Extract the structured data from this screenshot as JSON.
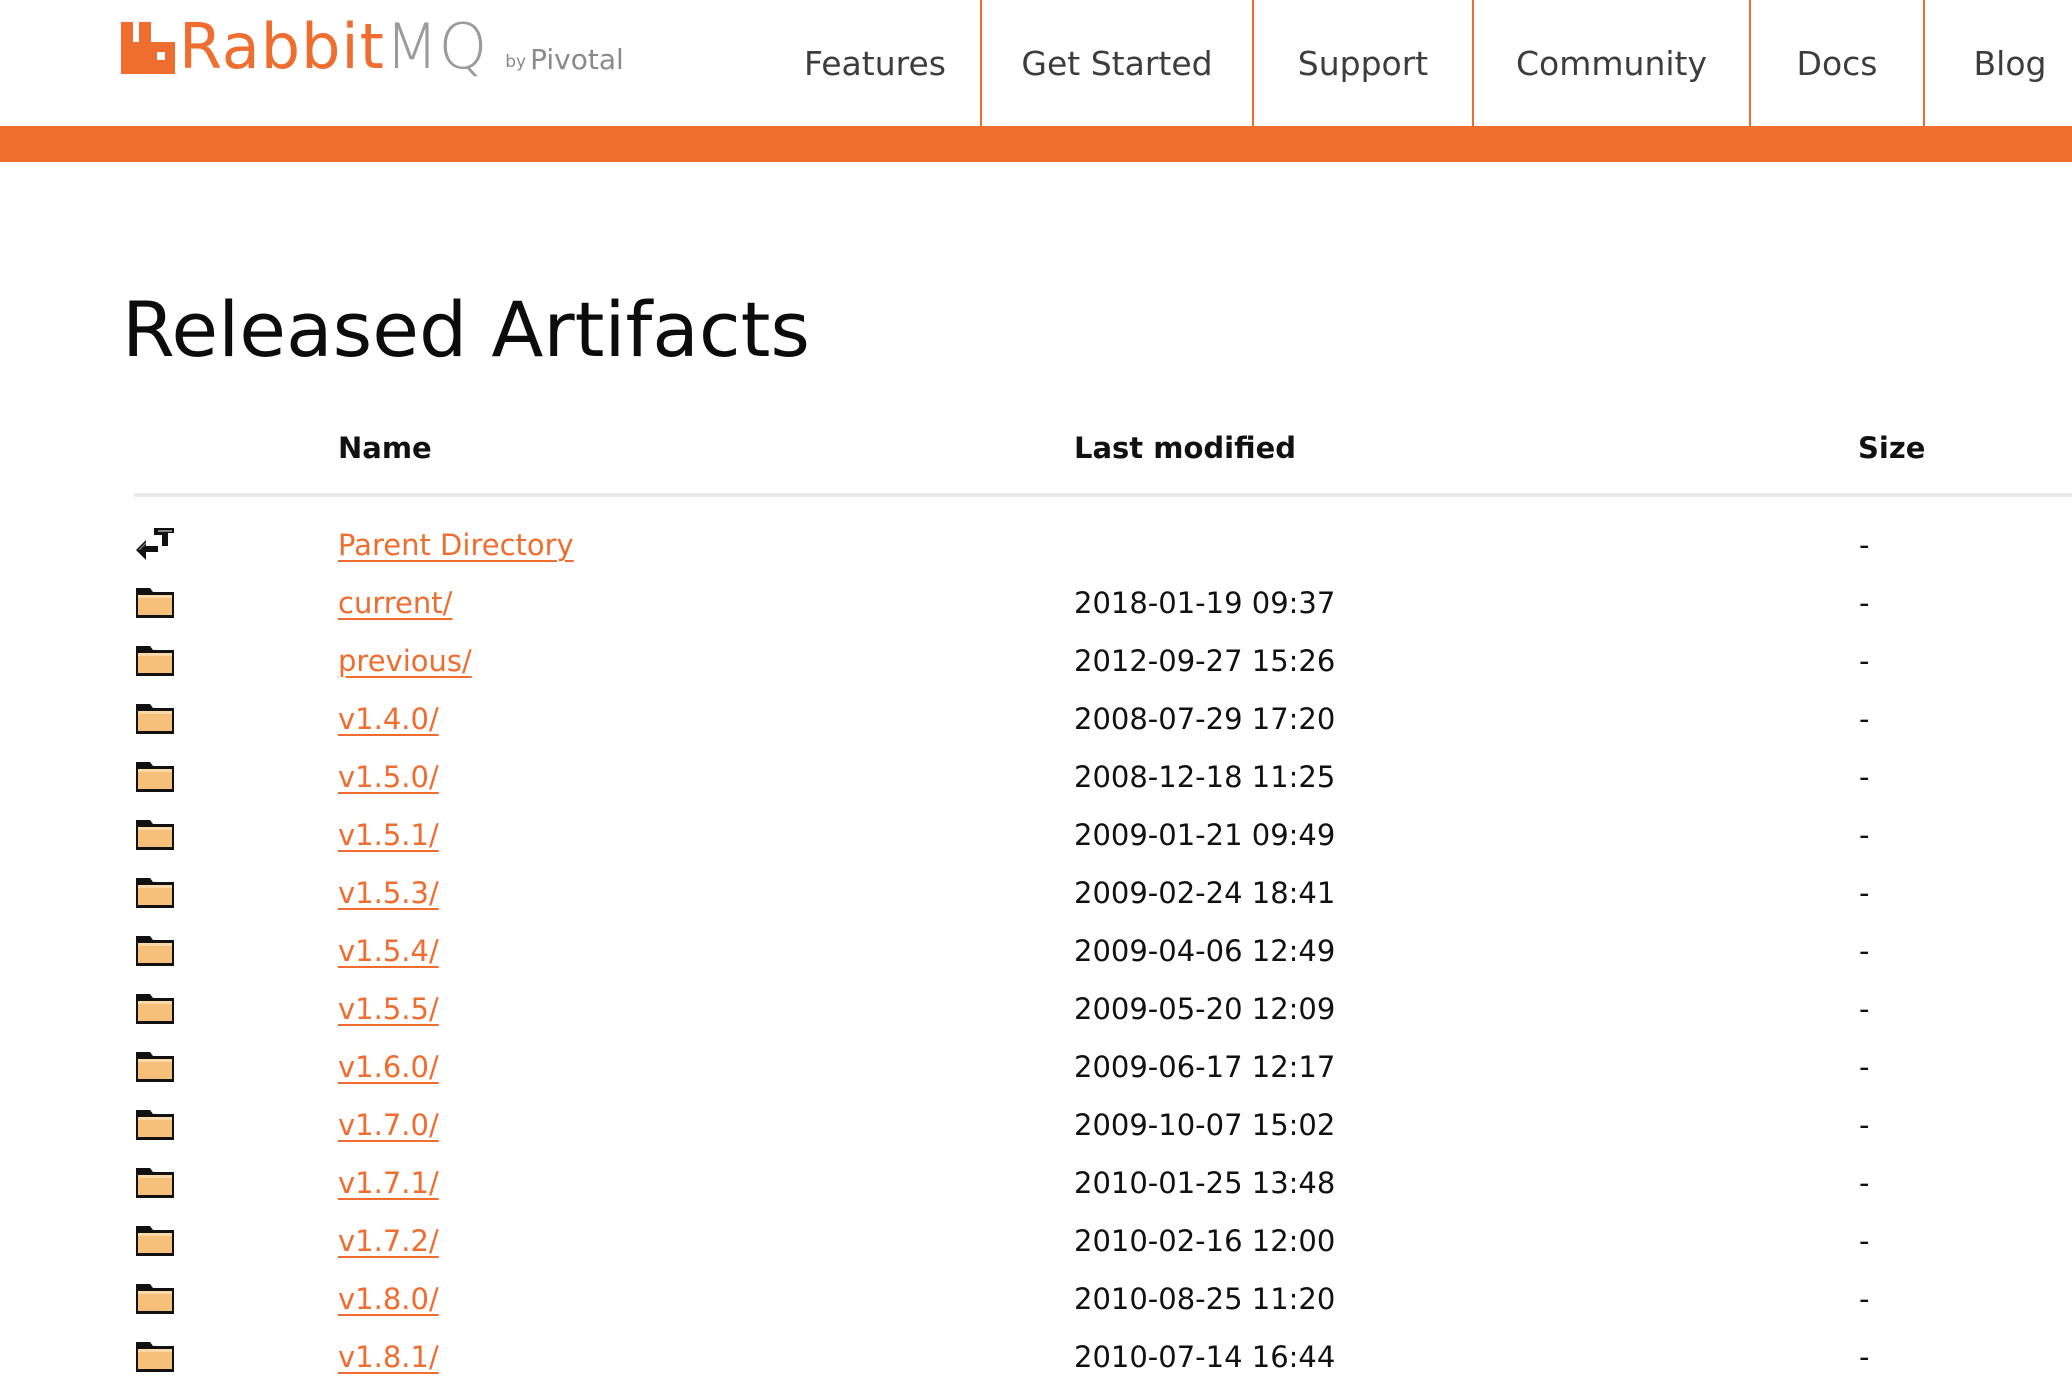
{
  "brand": {
    "name_part1": "Rabbit",
    "name_part2": "MQ",
    "by": "by",
    "company": "Pivotal",
    "accent_color": "#f06d30"
  },
  "nav": {
    "items": [
      {
        "label": "Features"
      },
      {
        "label": "Get Started"
      },
      {
        "label": "Support"
      },
      {
        "label": "Community"
      },
      {
        "label": "Docs"
      },
      {
        "label": "Blog"
      }
    ]
  },
  "page": {
    "title": "Released Artifacts"
  },
  "table": {
    "headers": {
      "name": "Name",
      "last_modified": "Last modified",
      "size": "Size"
    },
    "rows": [
      {
        "icon": "back-arrow-icon",
        "name": "Parent Directory",
        "date": "",
        "size": "-"
      },
      {
        "icon": "folder-icon",
        "name": "current/",
        "date": "2018-01-19 09:37",
        "size": "-"
      },
      {
        "icon": "folder-icon",
        "name": "previous/",
        "date": "2012-09-27 15:26",
        "size": "-"
      },
      {
        "icon": "folder-icon",
        "name": "v1.4.0/",
        "date": "2008-07-29 17:20",
        "size": "-"
      },
      {
        "icon": "folder-icon",
        "name": "v1.5.0/",
        "date": "2008-12-18 11:25",
        "size": "-"
      },
      {
        "icon": "folder-icon",
        "name": "v1.5.1/",
        "date": "2009-01-21 09:49",
        "size": "-"
      },
      {
        "icon": "folder-icon",
        "name": "v1.5.3/",
        "date": "2009-02-24 18:41",
        "size": "-"
      },
      {
        "icon": "folder-icon",
        "name": "v1.5.4/",
        "date": "2009-04-06 12:49",
        "size": "-"
      },
      {
        "icon": "folder-icon",
        "name": "v1.5.5/",
        "date": "2009-05-20 12:09",
        "size": "-"
      },
      {
        "icon": "folder-icon",
        "name": "v1.6.0/",
        "date": "2009-06-17 12:17",
        "size": "-"
      },
      {
        "icon": "folder-icon",
        "name": "v1.7.0/",
        "date": "2009-10-07 15:02",
        "size": "-"
      },
      {
        "icon": "folder-icon",
        "name": "v1.7.1/",
        "date": "2010-01-25 13:48",
        "size": "-"
      },
      {
        "icon": "folder-icon",
        "name": "v1.7.2/",
        "date": "2010-02-16 12:00",
        "size": "-"
      },
      {
        "icon": "folder-icon",
        "name": "v1.8.0/",
        "date": "2010-08-25 11:20",
        "size": "-"
      },
      {
        "icon": "folder-icon",
        "name": "v1.8.1/",
        "date": "2010-07-14 16:44",
        "size": "-"
      }
    ]
  }
}
